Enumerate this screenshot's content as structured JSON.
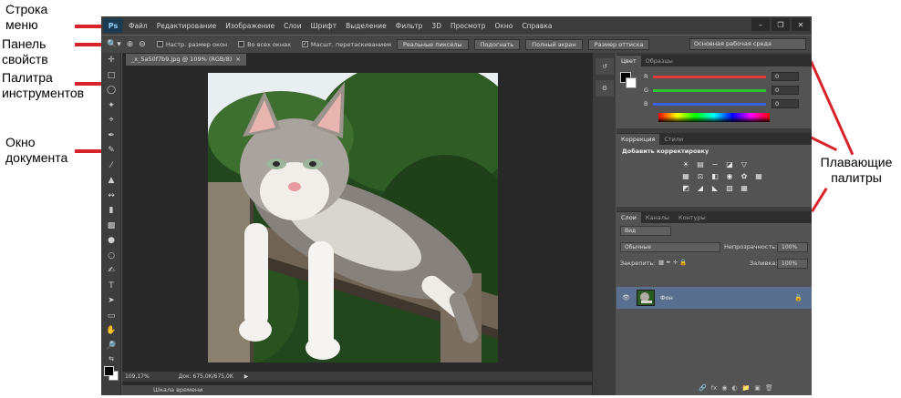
{
  "annotations": {
    "menu_bar": "Строка меню",
    "options_bar": "Панель свойств",
    "toolbox": "Палитра инструментов",
    "document": "Окно документа",
    "floating": "Плавающие палитры",
    "accent": "#d8232a"
  },
  "app": {
    "logo": "Ps",
    "menu": [
      "Файл",
      "Редактирование",
      "Изображение",
      "Слои",
      "Шрифт",
      "Выделение",
      "Фильтр",
      "3D",
      "Просмотр",
      "Окно",
      "Справка"
    ],
    "window_buttons": [
      "–",
      "❐",
      "✕"
    ],
    "options": {
      "zoom_icon": "zoom-icon",
      "checks": [
        {
          "label": "Настр. размер окон",
          "checked": false
        },
        {
          "label": "Во всех окнах",
          "checked": false
        },
        {
          "label": "Масшт. перетаскиванием",
          "checked": true
        }
      ],
      "buttons": [
        "Реальные пикселы",
        "Подогнать",
        "Полный экран",
        "Размер оттиска"
      ],
      "workspace": "Основная рабочая среда"
    },
    "document": {
      "tab_title": "_x_5a50f7b9.jpg @ 109% (RGB/8)",
      "tab_close": "×",
      "status_zoom": "109,17%",
      "status_doc": "Док: 675,0K/675,0K",
      "timeline": "Шкала времени"
    },
    "color_panel": {
      "tabs": [
        "Цвет",
        "Образцы"
      ],
      "channels": [
        {
          "label": "R",
          "value": "0",
          "color": "#e03a3a"
        },
        {
          "label": "G",
          "value": "0",
          "color": "#33c233"
        },
        {
          "label": "B",
          "value": "0",
          "color": "#3a5ee0"
        }
      ]
    },
    "adjustments_panel": {
      "tabs": [
        "Коррекция",
        "Стили"
      ],
      "title": "Добавить корректировку"
    },
    "layers_panel": {
      "tabs": [
        "Слои",
        "Каналы",
        "Контуры"
      ],
      "filter": "Вид",
      "blend_mode": "Обычные",
      "opacity_label": "Непрозрачность:",
      "opacity_value": "100%",
      "lock_label": "Закрепить:",
      "fill_label": "Заливка:",
      "fill_value": "100%",
      "layer_name": "Фон"
    }
  }
}
